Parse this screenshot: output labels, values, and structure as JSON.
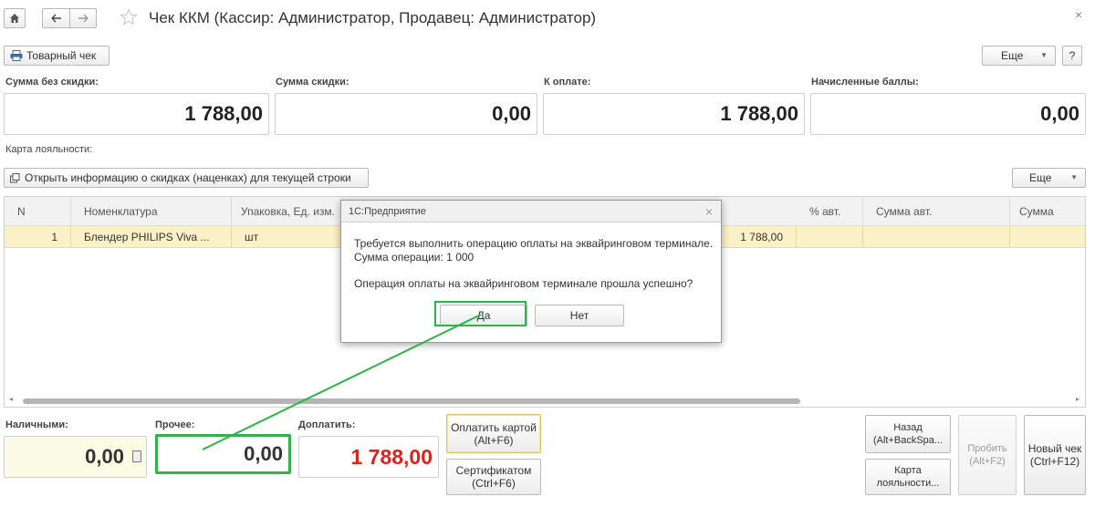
{
  "window": {
    "title": "Чек ККМ (Кассир: Администратор, Продавец: Администратор)"
  },
  "toolbar": {
    "receipt_button": "Товарный чек",
    "more_label": "Еще",
    "help_label": "?"
  },
  "summary": {
    "no_discount_label": "Сумма без скидки:",
    "no_discount_value": "1 788,00",
    "discount_label": "Сумма скидки:",
    "discount_value": "0,00",
    "to_pay_label": "К оплате:",
    "to_pay_value": "1 788,00",
    "points_label": "Начисленные баллы:",
    "points_value": "0,00"
  },
  "loyalty_label": "Карта лояльности:",
  "discount_info_button": "Открыть информацию о скидках (наценках) для текущей строки",
  "table_more_label": "Еще",
  "table": {
    "columns": [
      "N",
      "Номенклатура",
      "Упаковка, Ед. изм.",
      "% авт.",
      "Сумма авт.",
      "Сумма"
    ],
    "row": {
      "n": "1",
      "item": "Блендер PHILIPS Viva ...",
      "unit": "шт",
      "amount": "1 788,00"
    }
  },
  "dialog": {
    "title": "1С:Предприятие",
    "line1": "Требуется выполнить операцию оплаты на эквайринговом терминале.",
    "line2": "Сумма операции: 1 000",
    "question": "Операция оплаты на эквайринговом терминале прошла успешно?",
    "yes": "Да",
    "no": "Нет"
  },
  "payment": {
    "cash_label": "Наличными:",
    "cash_value": "0,00",
    "other_label": "Прочее:",
    "other_value": "0,00",
    "due_label": "Доплатить:",
    "due_value": "1 788,00"
  },
  "buttons": {
    "pay_card_line1": "Оплатить картой",
    "pay_card_line2": "(Alt+F6)",
    "certificate_line1": "Сертификатом",
    "certificate_line2": "(Ctrl+F6)",
    "back_line1": "Назад",
    "back_line2": "(Alt+BackSpa...",
    "loyalty_line1": "Карта",
    "loyalty_line2": "лояльности...",
    "punch_line1": "Пробить",
    "punch_line2": "(Alt+F2)",
    "new_line1": "Новый чек",
    "new_line2": "(Ctrl+F12)"
  },
  "colors": {
    "due_text": "#e0201c",
    "highlight": "#2fb34a",
    "selected_row": "#fbf1c6",
    "cash_field": "#fbfbe6"
  }
}
